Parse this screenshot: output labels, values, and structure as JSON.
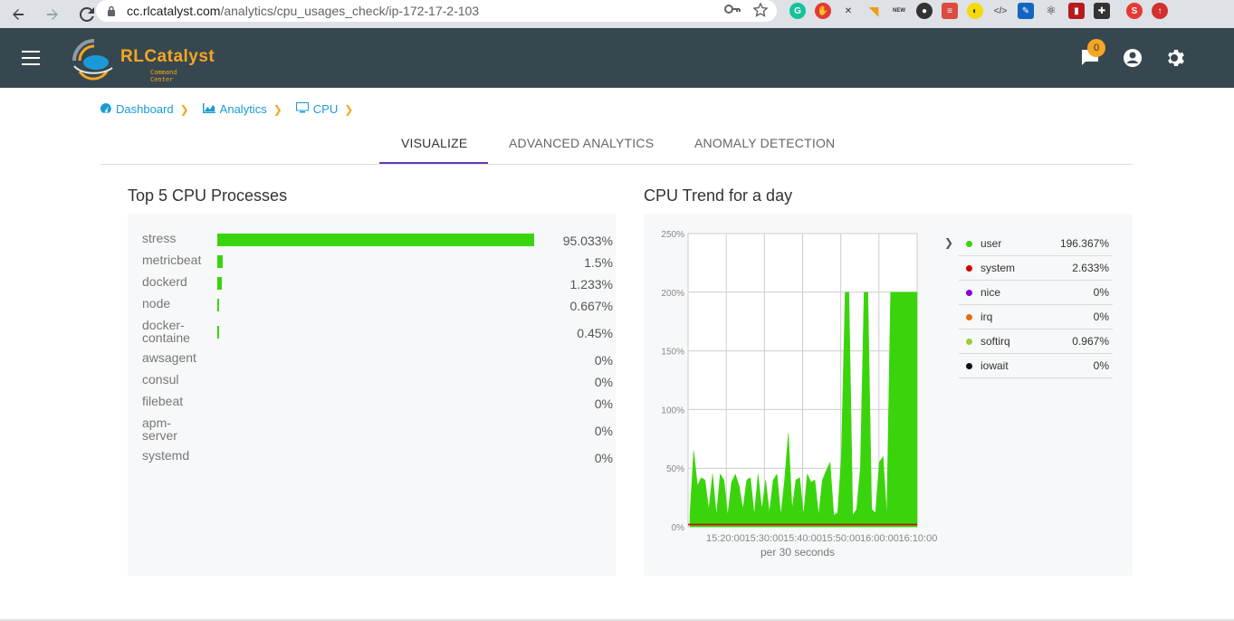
{
  "browser": {
    "url_host": "cc.rlcatalyst.com",
    "url_path": "/analytics/cpu_usages_check/ip-172-17-2-103"
  },
  "app": {
    "logo_text": "RLCatalyst",
    "logo_sub": "Command Center",
    "notification_count": "0"
  },
  "breadcrumb": [
    {
      "label": "Dashboard",
      "icon": "dashboard-icon"
    },
    {
      "label": "Analytics",
      "icon": "area-chart-icon"
    },
    {
      "label": "CPU",
      "icon": "monitor-icon"
    }
  ],
  "tabs": [
    {
      "label": "VISUALIZE",
      "active": true
    },
    {
      "label": "ADVANCED ANALYTICS",
      "active": false
    },
    {
      "label": "ANOMALY DETECTION",
      "active": false
    }
  ],
  "processes": {
    "title": "Top 5 CPU Processes",
    "bar_color": "#3ad40c",
    "rows": [
      {
        "name": "stress",
        "value": 95.033,
        "label": "95.033%"
      },
      {
        "name": "metricbeat",
        "value": 1.5,
        "label": "1.5%"
      },
      {
        "name": "dockerd",
        "value": 1.233,
        "label": "1.233%"
      },
      {
        "name": "node",
        "value": 0.667,
        "label": "0.667%"
      },
      {
        "name": "docker-containe",
        "value": 0.45,
        "label": "0.45%"
      },
      {
        "name": "awsagent",
        "value": 0,
        "label": "0%"
      },
      {
        "name": "consul",
        "value": 0,
        "label": "0%"
      },
      {
        "name": "filebeat",
        "value": 0,
        "label": "0%"
      },
      {
        "name": "apm-server",
        "value": 0,
        "label": "0%"
      },
      {
        "name": "systemd",
        "value": 0,
        "label": "0%"
      }
    ]
  },
  "trend": {
    "title": "CPU Trend for a day",
    "x_caption": "per 30 seconds",
    "legend": [
      {
        "name": "user",
        "color": "#3ad40c",
        "value": "196.367%"
      },
      {
        "name": "system",
        "color": "#d40000",
        "value": "2.633%"
      },
      {
        "name": "nice",
        "color": "#8a00d4",
        "value": "0%"
      },
      {
        "name": "irq",
        "color": "#e86a10",
        "value": "0%"
      },
      {
        "name": "softirq",
        "color": "#9acd32",
        "value": "0.967%"
      },
      {
        "name": "iowait",
        "color": "#111111",
        "value": "0%"
      }
    ]
  },
  "chart_data": {
    "type": "area",
    "title": "CPU Trend for a day",
    "xlabel": "per 30 seconds",
    "ylabel": "",
    "ylim": [
      0,
      250
    ],
    "yticks": [
      "0%",
      "50%",
      "100%",
      "150%",
      "200%",
      "250%"
    ],
    "xticks": [
      "15:20:00",
      "15:30:00",
      "15:40:00",
      "15:50:00",
      "16:00:00",
      "16:10:00"
    ],
    "grid": true,
    "legend_position": "right",
    "series": [
      {
        "name": "user",
        "color": "#3ad40c",
        "x": [
          "15:13",
          "15:14",
          "15:15",
          "15:16",
          "15:17",
          "15:18",
          "15:19",
          "15:20",
          "15:21",
          "15:22",
          "15:23",
          "15:24",
          "15:25",
          "15:26",
          "15:27",
          "15:28",
          "15:29",
          "15:30",
          "15:31",
          "15:32",
          "15:33",
          "15:34",
          "15:35",
          "15:36",
          "15:37",
          "15:38",
          "15:39",
          "15:40",
          "15:41",
          "15:42",
          "15:43",
          "15:44",
          "15:45",
          "15:46",
          "15:47",
          "15:48",
          "15:49",
          "15:50",
          "15:51",
          "15:52",
          "15:53",
          "15:54",
          "15:55",
          "15:56",
          "15:57",
          "15:58",
          "15:59",
          "16:00",
          "16:01",
          "16:02",
          "16:03",
          "16:04",
          "16:05",
          "16:06",
          "16:07",
          "16:08",
          "16:09",
          "16:10",
          "16:11",
          "16:12",
          "16:13"
        ],
        "values": [
          10,
          65,
          35,
          42,
          40,
          15,
          45,
          10,
          45,
          40,
          10,
          38,
          45,
          35,
          15,
          40,
          42,
          10,
          45,
          15,
          40,
          12,
          40,
          45,
          10,
          40,
          80,
          15,
          40,
          42,
          10,
          45,
          38,
          40,
          10,
          40,
          48,
          55,
          10,
          12,
          60,
          200,
          200,
          10,
          15,
          50,
          200,
          200,
          15,
          12,
          55,
          60,
          10,
          200,
          200,
          200,
          200,
          200,
          200,
          200,
          200
        ]
      },
      {
        "name": "system",
        "color": "#d40000",
        "x": [
          "15:13",
          "16:13"
        ],
        "values": [
          2,
          2
        ]
      }
    ]
  }
}
